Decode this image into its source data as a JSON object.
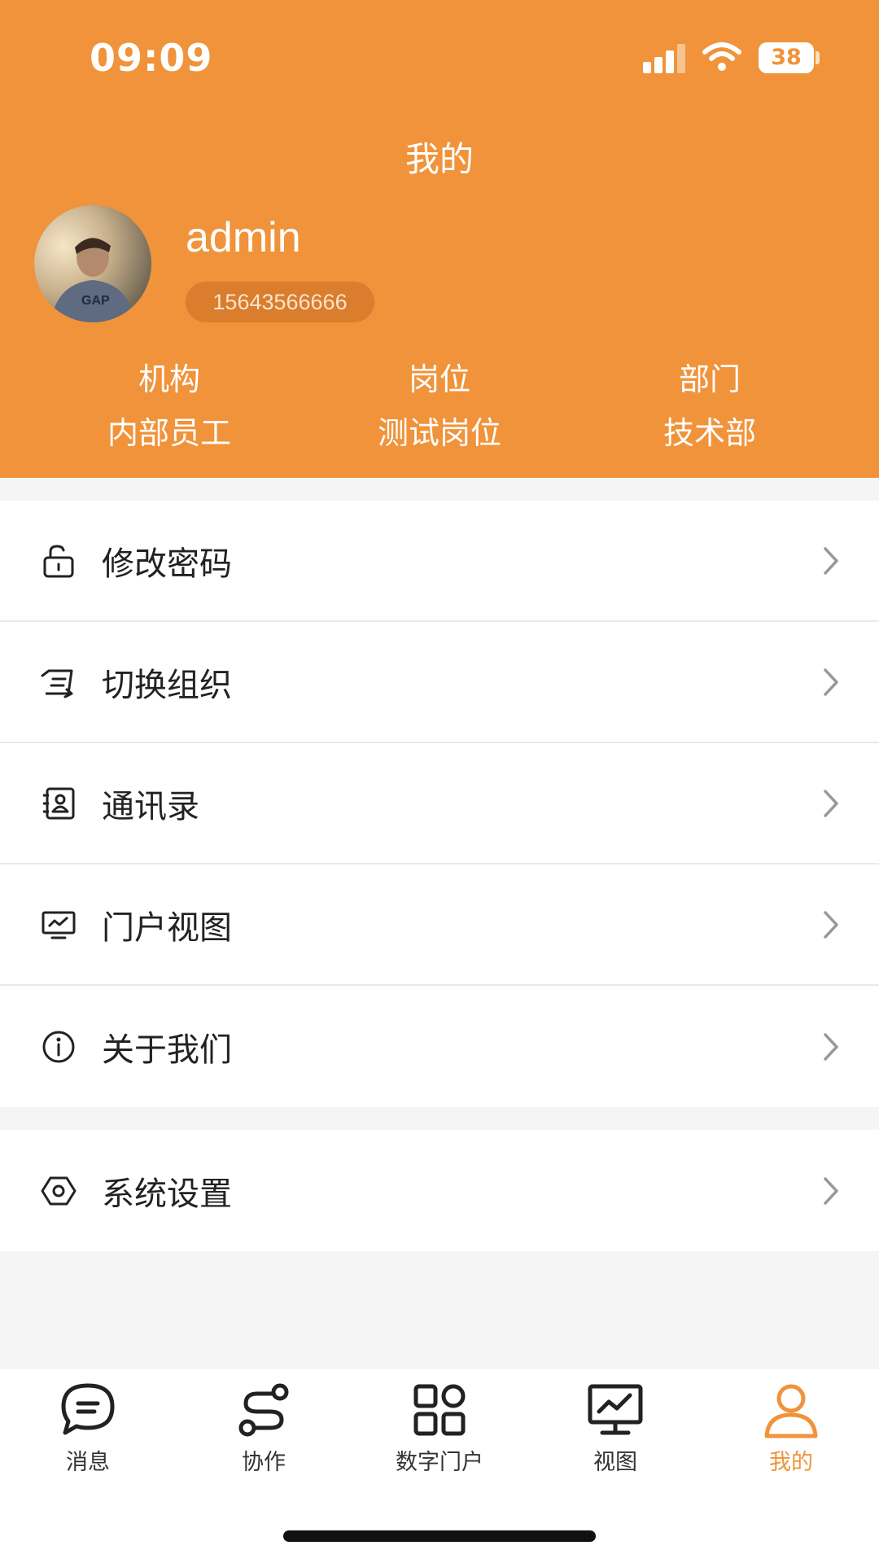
{
  "status_bar": {
    "time": "09:09",
    "battery": "38"
  },
  "header": {
    "title": "我的",
    "username": "admin",
    "phone": "15643566666",
    "info": [
      {
        "label": "机构",
        "value": "内部员工"
      },
      {
        "label": "岗位",
        "value": "测试岗位"
      },
      {
        "label": "部门",
        "value": "技术部"
      }
    ]
  },
  "menu": {
    "change_password": "修改密码",
    "switch_org": "切换组织",
    "contacts": "通讯录",
    "portal_view": "门户视图",
    "about_us": "关于我们",
    "system_settings": "系统设置"
  },
  "tabbar": {
    "messages": "消息",
    "collaboration": "协作",
    "digital_portal": "数字门户",
    "view": "视图",
    "mine": "我的"
  },
  "colors": {
    "accent": "#f0933a",
    "text": "#222222",
    "chevron": "#999999"
  },
  "icons": [
    "unlock-icon",
    "switch-icon",
    "contacts-icon",
    "monitor-icon",
    "info-icon",
    "settings-hexagon-icon",
    "chat-bubble-icon",
    "flow-icon",
    "grid-icon",
    "chart-monitor-icon",
    "user-icon"
  ]
}
